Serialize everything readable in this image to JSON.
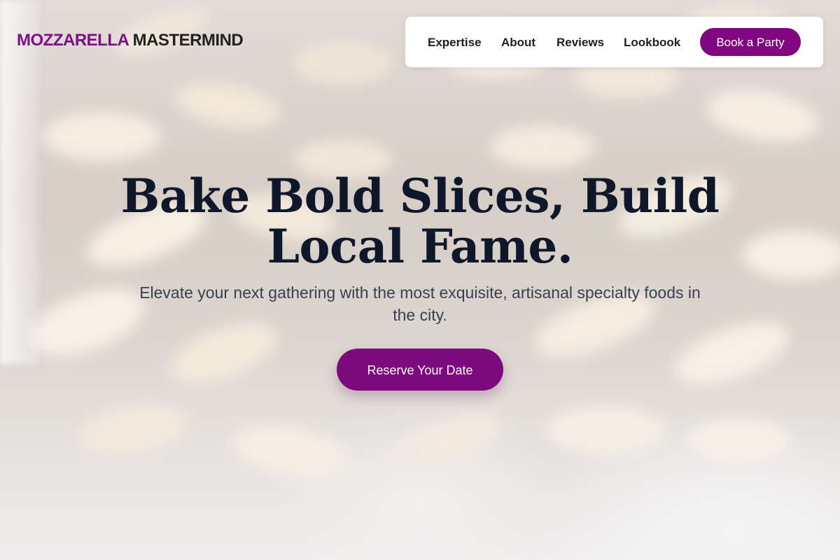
{
  "brand": {
    "accent_part": "MOZZARELLA",
    "rest_part": "MASTERMIND"
  },
  "nav": {
    "links": [
      {
        "label": "Expertise"
      },
      {
        "label": "About"
      },
      {
        "label": "Reviews"
      },
      {
        "label": "Lookbook"
      }
    ],
    "cta_label": "Book a Party"
  },
  "hero": {
    "title_line1": "Bake Bold Slices, Build",
    "title_line2": "Local Fame.",
    "subtitle": "Elevate your next gathering with the most exquisite, artisanal specialty foods in the city.",
    "cta_label": "Reserve Your Date"
  },
  "colors": {
    "accent": "#80077f",
    "heading": "#0f172a",
    "body_text": "#374151"
  }
}
